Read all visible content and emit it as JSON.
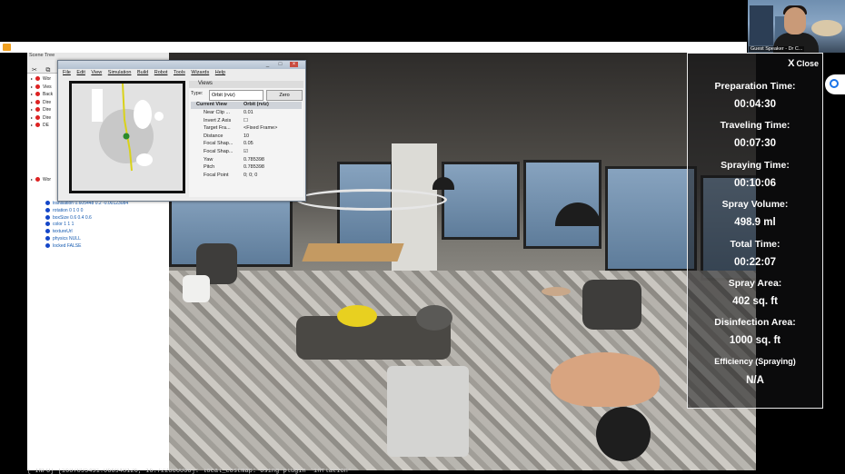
{
  "webcam": {
    "label": "Guest Speaker - Dr C..."
  },
  "scene_tree": {
    "title": "Scene Tree",
    "tools": [
      "✂",
      "⧉"
    ],
    "items": [
      {
        "text": "Wor",
        "dot": "red"
      },
      {
        "text": "Vies",
        "dot": "red"
      },
      {
        "text": "Back",
        "dot": "red"
      },
      {
        "text": "Dire",
        "dot": "red"
      },
      {
        "text": "Dire",
        "dot": "red"
      },
      {
        "text": "Dire",
        "dot": "red"
      },
      {
        "text": "DE",
        "dot": "red"
      },
      {
        "text": "Wor",
        "dot": "red"
      }
    ],
    "properties": [
      "translation 0.605448 0.2 -0.00123084",
      "rotation 0 1 0 0",
      "boxSize 0.6 0.4 0.6",
      "color 1 1 1",
      "textureUrl",
      "physics NULL",
      "locked FALSE"
    ]
  },
  "rviz": {
    "menu": [
      "File",
      "Edit",
      "View",
      "Simulation",
      "Build",
      "Robot",
      "Tools",
      "Wizards",
      "Help"
    ],
    "window_buttons": [
      "_",
      "□",
      "×"
    ],
    "views_title": "Views",
    "type_label": "Type:",
    "type_value": "Orbit (rviz)",
    "zero_button": "Zero",
    "current_view": {
      "key": "Current View",
      "value": "Orbit (rviz)"
    },
    "properties": [
      {
        "key": "Near Clip ...",
        "value": "0.01"
      },
      {
        "key": "Invert Z Axis",
        "value": "☐"
      },
      {
        "key": "Target Fra...",
        "value": "<Fixed Frame>"
      },
      {
        "key": "Distance",
        "value": "10"
      },
      {
        "key": "Focal Shap...",
        "value": "0.05"
      },
      {
        "key": "Focal Shap...",
        "value": "☑"
      },
      {
        "key": "Yaw",
        "value": "0.785398"
      },
      {
        "key": "Pitch",
        "value": "0.785398"
      },
      {
        "key": "Focal Point",
        "value": "0; 0; 0"
      }
    ]
  },
  "metrics": {
    "close_label": "Close",
    "rows": [
      {
        "label": "Preparation Time:",
        "value": "00:04:30"
      },
      {
        "label": "Traveling Time:",
        "value": "00:07:30"
      },
      {
        "label": "Spraying Time:",
        "value": "00:10:06"
      },
      {
        "label": "Spray Volume:",
        "value": "498.9 ml"
      },
      {
        "label": "Total Time:",
        "value": "00:22:07"
      },
      {
        "label": "Spray Area:",
        "value": "402 sq. ft"
      },
      {
        "label": "Disinfection Area:",
        "value": "1000 sq. ft"
      },
      {
        "label": "Efficiency (Spraying)",
        "value": "N/A"
      }
    ]
  },
  "console": {
    "text": "[ INFO] [1607095491.066948126, 16.722000000]: local_costmap: Using plugin \"inflation\""
  },
  "colors": {
    "accent_blue": "#1a73e8",
    "overlay_border": "#e8e8e8"
  }
}
